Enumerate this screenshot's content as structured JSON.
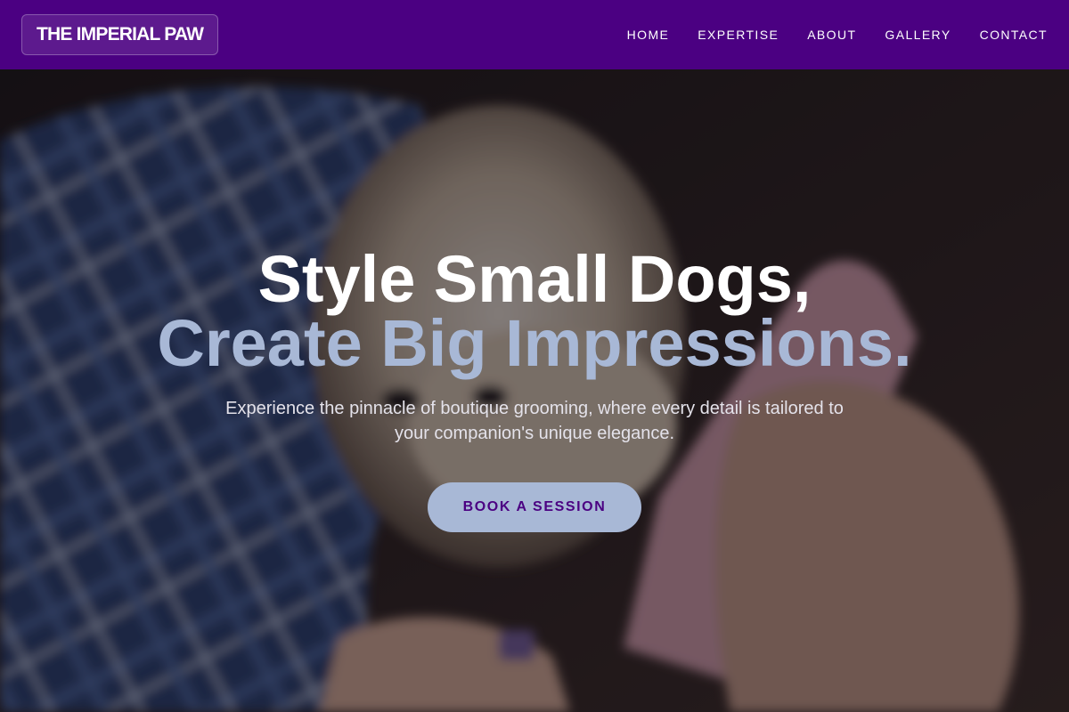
{
  "header": {
    "logo": "THE IMPERIAL PAW",
    "nav": [
      "HOME",
      "EXPERTISE",
      "ABOUT",
      "GALLERY",
      "CONTACT"
    ]
  },
  "hero": {
    "headline_line1": "Style Small Dogs,",
    "headline_line2": "Create Big Impressions.",
    "subtext": "Experience the pinnacle of boutique grooming, where every detail is tailored to your companion's unique elegance.",
    "cta_label": "BOOK A SESSION",
    "background_image": "dog-grooming-photo"
  },
  "colors": {
    "brand_purple": "#4b0082",
    "accent_blue": "#a8b8d6",
    "white": "#ffffff"
  }
}
